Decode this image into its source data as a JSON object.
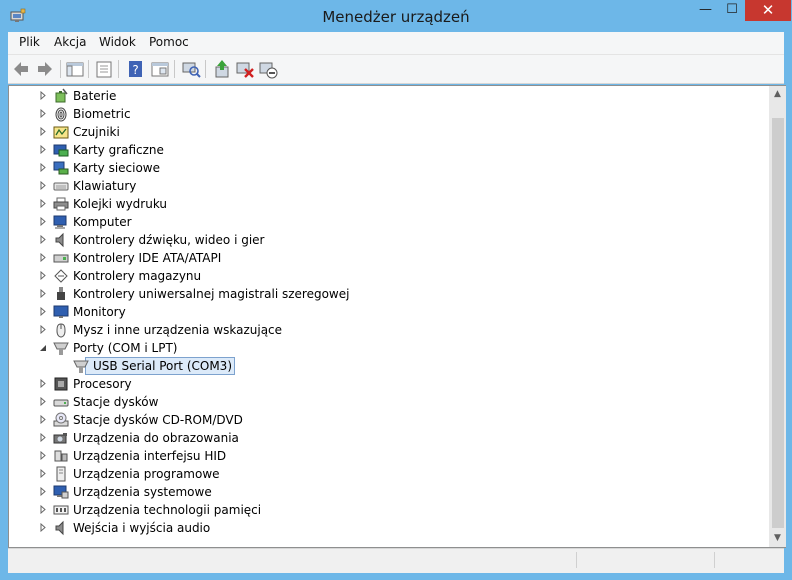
{
  "window": {
    "title": "Menedżer urządzeń",
    "controls": {
      "minimize": "—",
      "maximize": "☐",
      "close": "✕"
    }
  },
  "menubar": {
    "items": [
      "Plik",
      "Akcja",
      "Widok",
      "Pomoc"
    ]
  },
  "toolbar": {
    "buttons": [
      "back-arrow-icon",
      "forward-arrow-icon",
      "show-hide-console-tree-icon",
      "properties-icon",
      "help-icon",
      "view-icon",
      "scan-hardware-icon",
      "update-driver-icon",
      "uninstall-icon",
      "disable-device-icon"
    ]
  },
  "tree": {
    "items": [
      {
        "label": "Baterie",
        "icon": "battery-icon",
        "expanded": false
      },
      {
        "label": "Biometric",
        "icon": "fingerprint-icon",
        "expanded": false
      },
      {
        "label": "Czujniki",
        "icon": "sensor-icon",
        "expanded": false
      },
      {
        "label": "Karty graficzne",
        "icon": "display-adapter-icon",
        "expanded": false
      },
      {
        "label": "Karty sieciowe",
        "icon": "network-adapter-icon",
        "expanded": false
      },
      {
        "label": "Klawiatury",
        "icon": "keyboard-icon",
        "expanded": false
      },
      {
        "label": "Kolejki wydruku",
        "icon": "printer-icon",
        "expanded": false
      },
      {
        "label": "Komputer",
        "icon": "computer-icon",
        "expanded": false
      },
      {
        "label": "Kontrolery dźwięku, wideo i gier",
        "icon": "speaker-icon",
        "expanded": false
      },
      {
        "label": "Kontrolery IDE ATA/ATAPI",
        "icon": "ide-controller-icon",
        "expanded": false
      },
      {
        "label": "Kontrolery magazynu",
        "icon": "storage-controller-icon",
        "expanded": false
      },
      {
        "label": "Kontrolery uniwersalnej magistrali szeregowej",
        "icon": "usb-plug-icon",
        "expanded": false
      },
      {
        "label": "Monitory",
        "icon": "monitor-icon",
        "expanded": false
      },
      {
        "label": "Mysz i inne urządzenia wskazujące",
        "icon": "mouse-icon",
        "expanded": false
      },
      {
        "label": "Porty (COM i LPT)",
        "icon": "port-icon",
        "expanded": true
      },
      {
        "label": "USB Serial Port (COM3)",
        "icon": "port-icon",
        "child": true,
        "selected": true
      },
      {
        "label": "Procesory",
        "icon": "processor-icon",
        "expanded": false
      },
      {
        "label": "Stacje dysków",
        "icon": "disk-drive-icon",
        "expanded": false
      },
      {
        "label": "Stacje dysków CD-ROM/DVD",
        "icon": "cdrom-icon",
        "expanded": false
      },
      {
        "label": "Urządzenia do obrazowania",
        "icon": "camera-icon",
        "expanded": false
      },
      {
        "label": "Urządzenia interfejsu HID",
        "icon": "hid-icon",
        "expanded": false
      },
      {
        "label": "Urządzenia programowe",
        "icon": "software-device-icon",
        "expanded": false
      },
      {
        "label": "Urządzenia systemowe",
        "icon": "system-device-icon",
        "expanded": false
      },
      {
        "label": "Urządzenia technologii pamięci",
        "icon": "memory-tech-icon",
        "expanded": false
      },
      {
        "label": "Wejścia i wyjścia audio",
        "icon": "audio-io-icon",
        "expanded": false
      }
    ]
  },
  "scrollbar": {
    "up": "▲",
    "down": "▼"
  },
  "colors": {
    "frame": "#6db7e8",
    "close_button": "#c7372f",
    "selection_fill": "#dceaf9",
    "selection_border": "#7da2ce"
  }
}
